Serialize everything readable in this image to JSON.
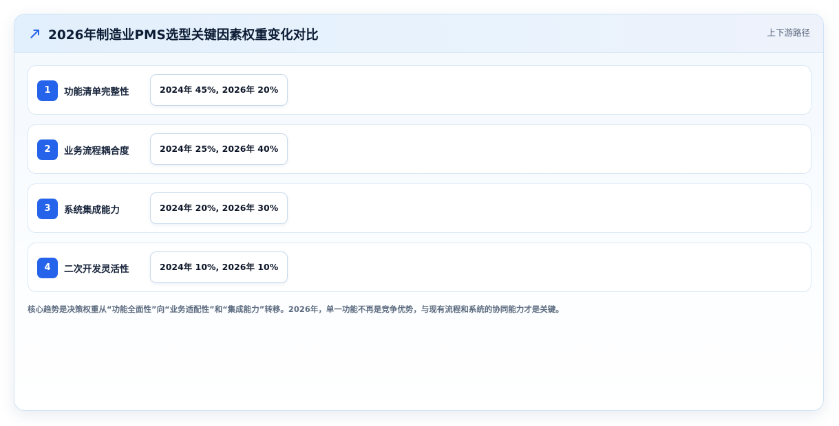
{
  "header": {
    "icon": "trend-up-arrow-icon",
    "title": "2026年制造业PMS选型关键因素权重变化对比",
    "tag": "上下游路径"
  },
  "factors": [
    {
      "index": "1",
      "label": "功能清单完整性",
      "value": "2024年 45%, 2026年 20%"
    },
    {
      "index": "2",
      "label": "业务流程耦合度",
      "value": "2024年 25%, 2026年 40%"
    },
    {
      "index": "3",
      "label": "系统集成能力",
      "value": "2024年 20%, 2026年 30%"
    },
    {
      "index": "4",
      "label": "二次开发灵活性",
      "value": "2024年 10%, 2026年 10%"
    }
  ],
  "footnote": "核心趋势是决策权重从“功能全面性”向“业务适配性”和“集成能力”转移。2026年，单一功能不再是竞争优势，与现有流程和系统的协同能力才是关键。",
  "colors": {
    "accent": "#2563eb",
    "title": "#0b1b33",
    "muted": "#5d6c80"
  }
}
